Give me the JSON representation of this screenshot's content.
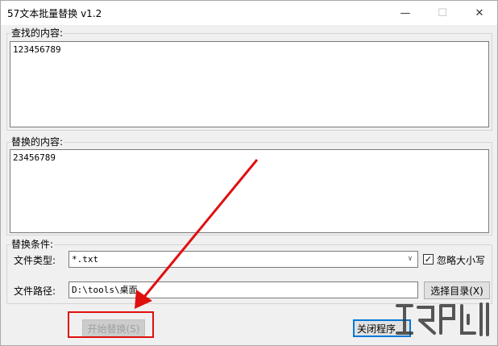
{
  "window": {
    "title": "57文本批量替换 v1.2",
    "min_icon": "minimize-icon",
    "max_icon": "maximize-icon",
    "close_icon": "close-icon"
  },
  "find": {
    "label": "查找的内容:",
    "value": "123456789"
  },
  "replace": {
    "label": "替换的内容:",
    "value": "23456789"
  },
  "conditions": {
    "label": "替换条件:",
    "file_type_label": "文件类型:",
    "file_type_value": "*.txt",
    "ignore_case_label": "忽略大小写",
    "ignore_case_checked": true,
    "file_path_label": "文件路径:",
    "file_path_value": "D:\\tools\\桌面",
    "choose_dir_button": "选择目录(X)"
  },
  "actions": {
    "start_button": "开始替换(S)",
    "close_button": "关闭程序"
  },
  "annotation": {
    "color": "#e01010"
  }
}
